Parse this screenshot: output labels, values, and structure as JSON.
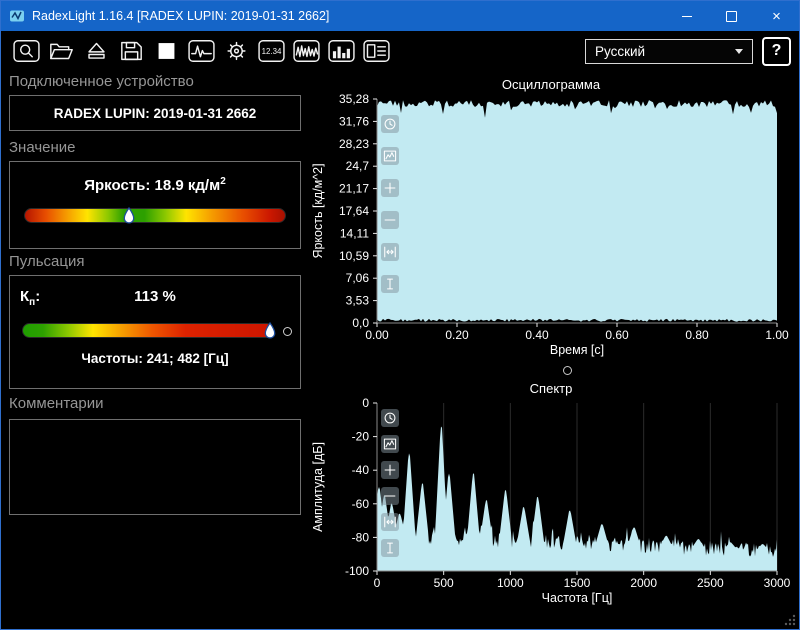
{
  "window": {
    "title": "RadexLight 1.16.4 [RADEX LUPIN: 2019-01-31 2662]"
  },
  "titlebar": {
    "controls": [
      "minimize",
      "maximize",
      "close"
    ]
  },
  "colors": {
    "titlebar": "#1565c8",
    "accent_border": "#2f6fce",
    "chart_fill": "#c2eaf2"
  },
  "toolbar": {
    "buttons": [
      {
        "name": "zoom-search",
        "icon": "search"
      },
      {
        "name": "open-file",
        "icon": "folder-open"
      },
      {
        "name": "eject-device",
        "icon": "eject"
      },
      {
        "name": "save",
        "icon": "save"
      },
      {
        "name": "stop",
        "icon": "stop"
      },
      {
        "name": "pulse-mode",
        "icon": "pulse"
      },
      {
        "name": "gear-mode",
        "icon": "gear"
      },
      {
        "name": "numeric-display",
        "icon": "digits"
      },
      {
        "name": "oscillogram-mode",
        "icon": "wave"
      },
      {
        "name": "histogram-mode",
        "icon": "bars"
      },
      {
        "name": "report-layout",
        "icon": "report"
      }
    ],
    "language_value": "Русский",
    "help_label": "?"
  },
  "device_panel": {
    "header": "Подключенное устройство",
    "device_name": "RADEX LUPIN: 2019-01-31 2662"
  },
  "value_panel": {
    "header": "Значение",
    "label": "Яркость:",
    "value": "18.9",
    "unit": "кд/м",
    "unit_sup": "2",
    "marker_pos": 0.4
  },
  "pulsation_panel": {
    "header": "Пульсация",
    "kp_base": "К",
    "kp_sub": "п",
    "kp_colon": ":",
    "kp_value": "113 %",
    "marker_pos": 0.985,
    "freq_text": "Частоты: 241; 482 [Гц]"
  },
  "comments_panel": {
    "header": "Комментарии",
    "text": ""
  },
  "chart_data": [
    {
      "type": "area",
      "title": "Осциллограмма",
      "xlabel": "Время [с]",
      "ylabel": "Яркость [кд/м^2]",
      "xlim": [
        0,
        1.0
      ],
      "ylim": [
        0,
        35.28
      ],
      "xticks": [
        "0.00",
        "0.20",
        "0.40",
        "0.60",
        "0.80",
        "1.00"
      ],
      "yticks": [
        "0,0",
        "3,53",
        "7,06",
        "10,59",
        "14,11",
        "17,64",
        "21,17",
        "24,7",
        "28,23",
        "31,76",
        "35,28"
      ],
      "signal": {
        "frequency_hz": 241,
        "envelope_top": 34.4,
        "envelope_bottom": 0.2
      },
      "fill_color": "#c2eaf2",
      "grid": false,
      "tools": [
        "clock",
        "chart",
        "zoom-in",
        "zoom-out",
        "fit-width",
        "cursor"
      ]
    },
    {
      "type": "area",
      "title": "Спектр",
      "xlabel": "Частота [Гц]",
      "ylabel": "Амплитуда [дБ]",
      "xlim": [
        0,
        3000
      ],
      "ylim": [
        -100,
        0
      ],
      "xticks": [
        "0",
        "500",
        "1000",
        "1500",
        "2000",
        "2500",
        "3000"
      ],
      "yticks": [
        "-100",
        "-80",
        "-60",
        "-40",
        "-20",
        "0"
      ],
      "noise_floor_db": [
        -79,
        -88
      ],
      "peaks": [
        {
          "f": 15,
          "db": -50
        },
        {
          "f": 55,
          "db": -55
        },
        {
          "f": 110,
          "db": -60
        },
        {
          "f": 170,
          "db": -66
        },
        {
          "f": 241,
          "db": -30
        },
        {
          "f": 340,
          "db": -48
        },
        {
          "f": 482,
          "db": -14
        },
        {
          "f": 540,
          "db": -42
        },
        {
          "f": 723,
          "db": -42
        },
        {
          "f": 820,
          "db": -58
        },
        {
          "f": 964,
          "db": -52
        },
        {
          "f": 1100,
          "db": -62
        },
        {
          "f": 1205,
          "db": -56
        },
        {
          "f": 1446,
          "db": -64
        },
        {
          "f": 1687,
          "db": -72
        },
        {
          "f": 1928,
          "db": -74
        },
        {
          "f": 2169,
          "db": -79
        },
        {
          "f": 2410,
          "db": -81
        },
        {
          "f": 2651,
          "db": -83
        },
        {
          "f": 2892,
          "db": -84
        }
      ],
      "fill_color": "#c2eaf2",
      "grid": true,
      "tools": [
        "clock",
        "chart",
        "zoom-in",
        "zoom-out",
        "fit-width",
        "cursor"
      ]
    }
  ]
}
